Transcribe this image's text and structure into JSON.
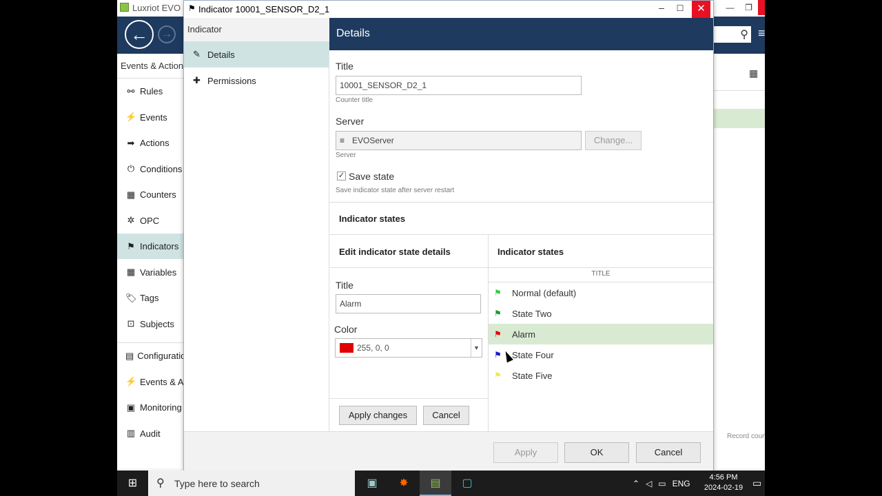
{
  "background_app": {
    "title": "Luxriot EVO",
    "section": "Events & Actions",
    "nav_items": [
      {
        "icon": "rules-icon",
        "glyph": "⚯",
        "label": "Rules"
      },
      {
        "icon": "events-icon",
        "glyph": "⚡",
        "label": "Events"
      },
      {
        "icon": "actions-icon",
        "glyph": "➡",
        "label": "Actions"
      },
      {
        "icon": "conditions-icon",
        "glyph": "⏻",
        "label": "Conditions"
      },
      {
        "icon": "counters-icon",
        "glyph": "▦",
        "label": "Counters"
      },
      {
        "icon": "opc-icon",
        "glyph": "✲",
        "label": "OPC"
      },
      {
        "icon": "indicators-icon",
        "glyph": "⚑",
        "label": "Indicators"
      },
      {
        "icon": "variables-icon",
        "glyph": "▦",
        "label": "Variables"
      },
      {
        "icon": "tags-icon",
        "glyph": "🏷",
        "label": "Tags"
      },
      {
        "icon": "subjects-icon",
        "glyph": "⊡",
        "label": "Subjects"
      }
    ],
    "bottom_nav": [
      {
        "icon": "configuration-icon",
        "glyph": "▤",
        "label": "Configuration"
      },
      {
        "icon": "events-actions-icon",
        "glyph": "⚡",
        "label": "Events & Actions"
      },
      {
        "icon": "monitoring-icon",
        "glyph": "▣",
        "label": "Monitoring"
      },
      {
        "icon": "audit-icon",
        "glyph": "▥",
        "label": "Audit"
      }
    ],
    "record_count": "Record count"
  },
  "dialog": {
    "title": "Indicator 10001_SENSOR_D2_1",
    "nav_header": "Indicator",
    "nav_items": [
      {
        "icon": "pencil-icon",
        "glyph": "✎",
        "label": "Details"
      },
      {
        "icon": "puzzle-icon",
        "glyph": "✚",
        "label": "Permissions"
      }
    ],
    "details_header": "Details",
    "title_label": "Title",
    "title_value": "10001_SENSOR_D2_1",
    "title_hint": "Counter title",
    "server_label": "Server",
    "server_value": "EVOServer",
    "server_hint": "Server",
    "change_button": "Change...",
    "save_state_label": "Save state",
    "save_state_checked": true,
    "save_state_hint": "Save indicator state after server restart",
    "indicator_states_section": "Indicator states",
    "edit_panel_title": "Edit indicator state details",
    "states_panel_title": "Indicator states",
    "state_title_label": "Title",
    "state_title_value": "Alarm",
    "color_label": "Color",
    "color_value": "255, 0, 0",
    "color_hex": "#e00000",
    "apply_changes_button": "Apply changes",
    "cancel_edit_button": "Cancel",
    "states_column_header": "TITLE",
    "states": [
      {
        "label": "Normal (default)",
        "color": "#2ecc40",
        "selected": false
      },
      {
        "label": "State Two",
        "color": "#1a9a2a",
        "selected": false
      },
      {
        "label": "Alarm",
        "color": "#e00000",
        "selected": true
      },
      {
        "label": "State Four",
        "color": "#1a1acc",
        "selected": false
      },
      {
        "label": "State Five",
        "color": "#f5e642",
        "selected": false
      }
    ],
    "footer_apply": "Apply",
    "footer_ok": "OK",
    "footer_cancel": "Cancel"
  },
  "taskbar": {
    "search_placeholder": "Type here to search",
    "language": "ENG",
    "time": "4:56 PM",
    "date": "2024-02-19"
  }
}
